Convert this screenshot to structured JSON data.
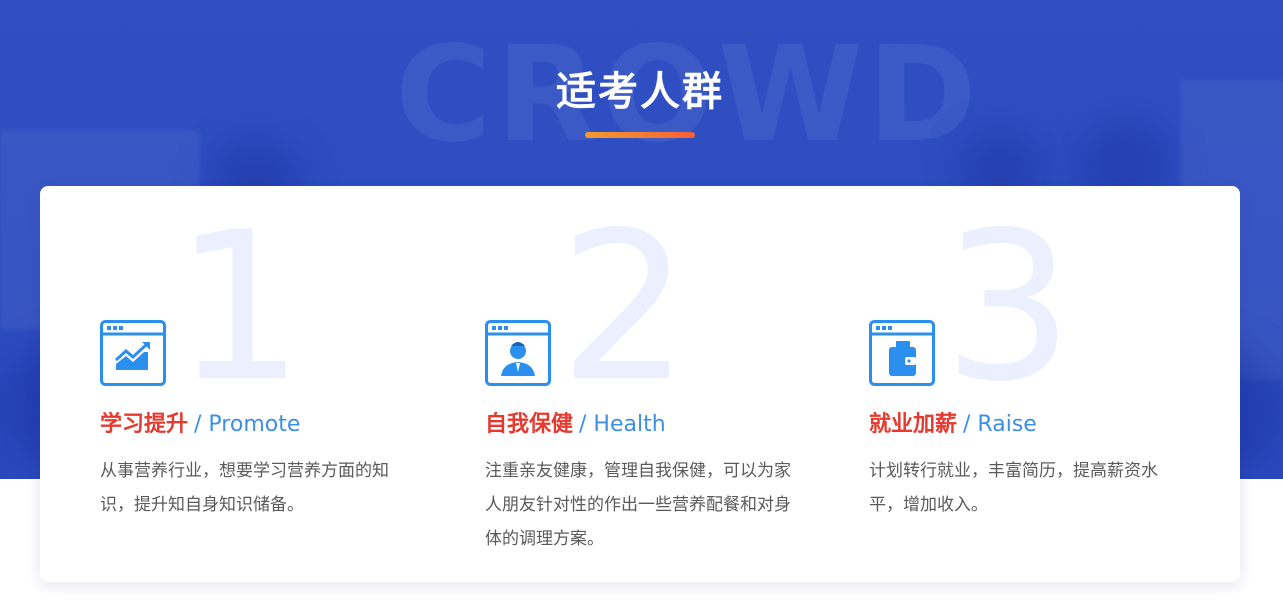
{
  "section": {
    "bg_word": "CROWD",
    "title": "适考人群"
  },
  "colors": {
    "hero_blue": "#2f4fc2",
    "title_red": "#e53a2f",
    "subtitle_blue": "#3d8fe6",
    "icon_blue": "#2b8ff0",
    "underline_orange": "#f39a2c"
  },
  "items": [
    {
      "number": "1",
      "icon": "growth-chart-window-icon",
      "title_zh": "学习提升",
      "title_en": "/ Promote",
      "desc": "从事营养行业，想要学习营养方面的知识，提升知自身知识储备。"
    },
    {
      "number": "2",
      "icon": "person-window-icon",
      "title_zh": "自我保健",
      "title_en": "/ Health",
      "desc": "注重亲友健康，管理自我保健，可以为家人朋友针对性的作出一些营养配餐和对身体的调理方案。"
    },
    {
      "number": "3",
      "icon": "wallet-window-icon",
      "title_zh": "就业加薪",
      "title_en": "/ Raise",
      "desc": "计划转行就业，丰富简历，提高薪资水平，增加收入。"
    }
  ]
}
